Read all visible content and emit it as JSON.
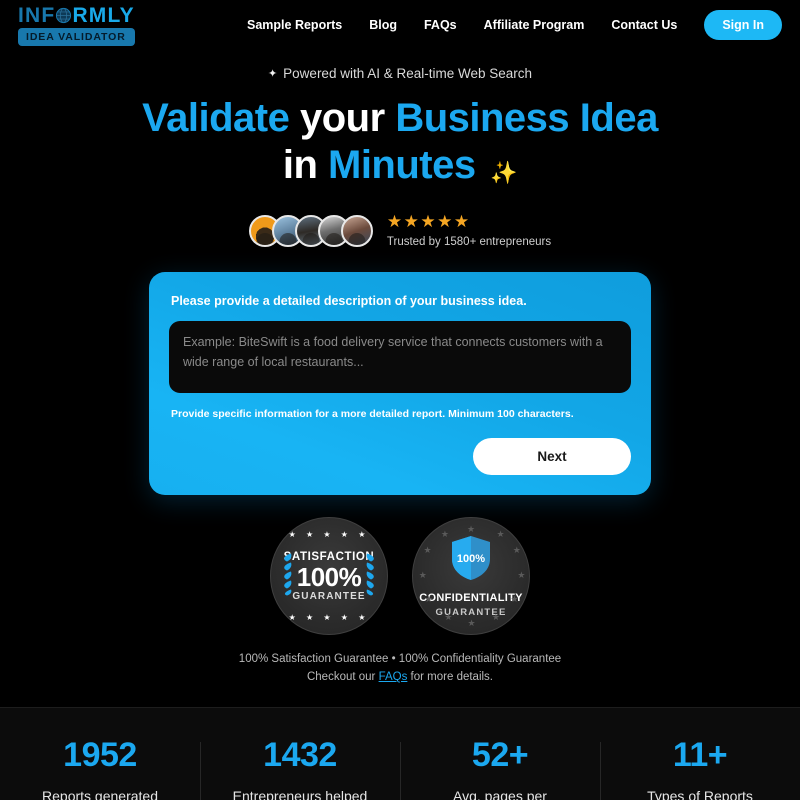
{
  "header": {
    "logo": {
      "part1": "INF",
      "globe_icon": "globe-icon",
      "part2": "RMLY",
      "badge": "IDEA VALIDATOR"
    },
    "nav": [
      {
        "label": "Sample Reports"
      },
      {
        "label": "Blog"
      },
      {
        "label": "FAQs"
      },
      {
        "label": "Affiliate Program"
      },
      {
        "label": "Contact Us"
      }
    ],
    "signin_label": "Sign In",
    "accent_color": "#1db8f5"
  },
  "hero": {
    "kicker_icon": "sparkle-icon",
    "kicker": "Powered with AI & Real-time Web Search",
    "headline_line1_a": "Validate",
    "headline_line1_b": "your",
    "headline_line1_c": "Business Idea",
    "headline_line2_a": "in",
    "headline_line2_b": "Minutes",
    "headline_sparkle": "✨",
    "accent_color": "#1BA8F0"
  },
  "social_proof": {
    "avatar_count": 5,
    "stars": "★★★★★",
    "star_color": "#F5A623",
    "trusted_text": "Trusted by 1580+ entrepreneurs"
  },
  "form": {
    "label": "Please provide a detailed description of your business idea.",
    "textarea_value": "",
    "textarea_placeholder": "Example: BiteSwift is a food delivery service that connects customers with a wide range of local restaurants...",
    "hint": "Provide specific information for a more detailed report. Minimum 100 characters.",
    "next_label": "Next",
    "card_color": "#18ACEC"
  },
  "badges": {
    "satisfaction": {
      "title": "SATISFACTION",
      "percent": "100%",
      "subtitle": "GUARANTEE",
      "stars_top": "★ ★ ★ ★ ★",
      "stars_bottom": "★ ★ ★ ★ ★"
    },
    "confidentiality": {
      "shield_percent": "100%",
      "title": "CONFIDENTIALITY",
      "subtitle": "GUARANTEE"
    },
    "note_line1": "100% Satisfaction Guarantee • 100% Confidentiality Guarantee",
    "note_line2_pre": "Checkout our ",
    "note_link": "FAQs",
    "note_line2_post": " for more details."
  },
  "stats": [
    {
      "value": "1952",
      "label": "Reports generated"
    },
    {
      "value": "1432",
      "label": "Entrepreneurs helped"
    },
    {
      "value": "52+",
      "label": "Avg. pages per"
    },
    {
      "value": "11+",
      "label": "Types of Reports"
    }
  ]
}
